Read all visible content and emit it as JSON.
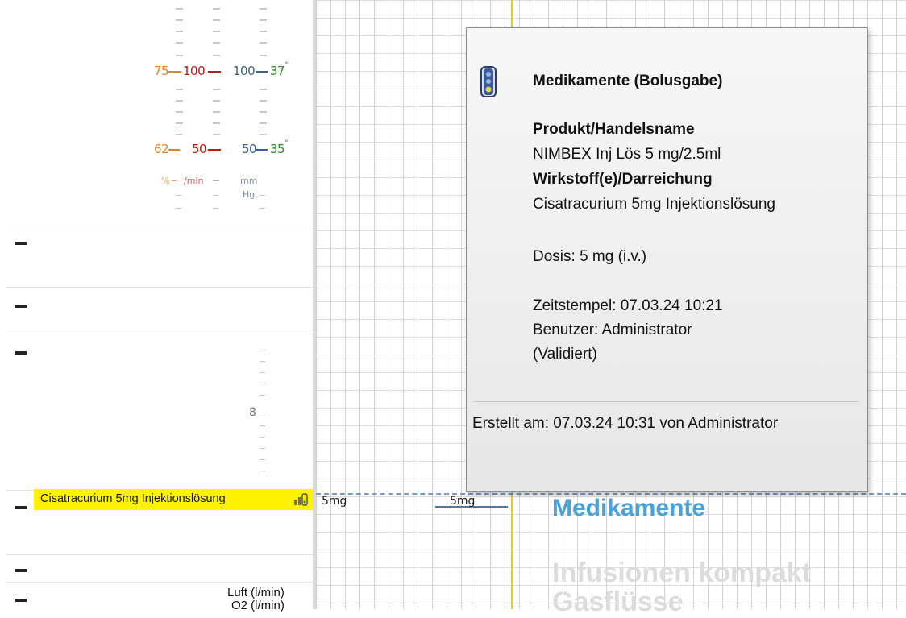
{
  "vitals_scale": {
    "spo2": {
      "top": "75",
      "bottom": "62",
      "unit": "%",
      "color": "#e0861f"
    },
    "heart_rate": {
      "top": "100",
      "bottom": "50",
      "unit": "/min",
      "color": "#c81414"
    },
    "blood_pressure": {
      "top": "100",
      "bottom": "50",
      "unit_line1": "mm",
      "unit_line2": "Hg",
      "color": "#3a5f8a"
    },
    "temperature": {
      "top": "37",
      "bottom": "35",
      "superscript": "°",
      "color": "#2e8b2e"
    }
  },
  "secondary_scale": {
    "value": "8",
    "color": "#777777"
  },
  "medication_row": {
    "label": "Cisatracurium 5mg Injektionslösung",
    "icon": "infusion-signal-icon",
    "highlight_color": "#fff200"
  },
  "chart": {
    "dose_labels": [
      "5mg",
      "5mg"
    ],
    "sections": [
      "Medikamente",
      "Infusionen kompakt",
      "Gasflüsse"
    ],
    "section_color_active": "#4aa3d6",
    "section_color_inactive": "#dcdcdc"
  },
  "gas_row": {
    "label1": "Luft (l/min)",
    "label2": "O2 (l/min)"
  },
  "tooltip": {
    "icon": "traffic-light-icon",
    "title": "Medikamente (Bolusgabe)",
    "product_heading": "Produkt/Handelsname",
    "product_value": "NIMBEX Inj Lös 5 mg/2.5ml",
    "substance_heading": "Wirkstoff(e)/Darreichung",
    "substance_value": "Cisatracurium 5mg Injektionslösung",
    "dose": "Dosis: 5 mg (i.v.)",
    "timestamp": "Zeitstempel: 07.03.24 10:21",
    "user": "Benutzer: Administrator",
    "status": "(Validiert)",
    "created": "Erstellt am: 07.03.24 10:31 von Administrator"
  }
}
